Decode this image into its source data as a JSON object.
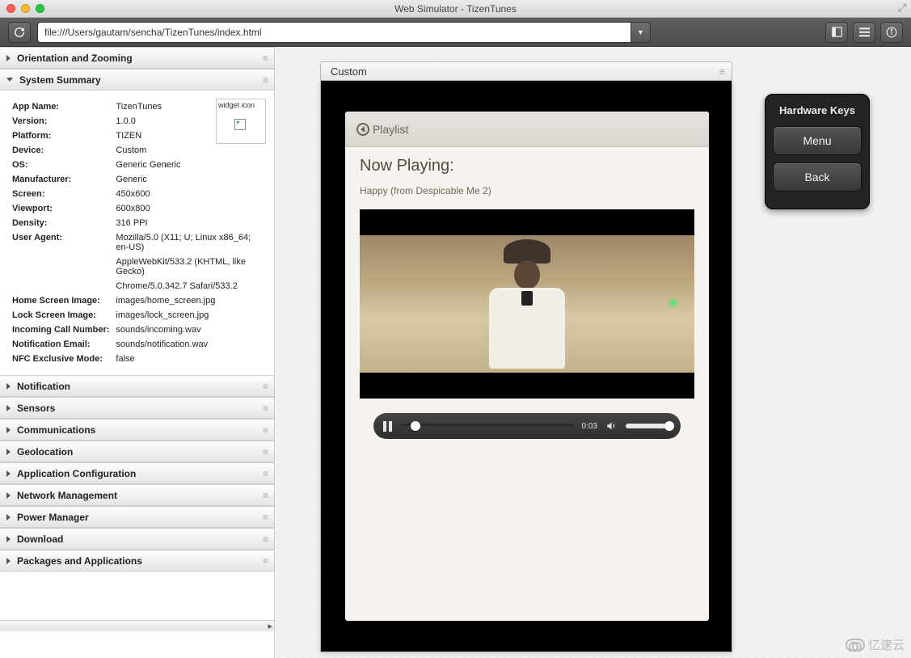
{
  "window": {
    "title": "Web Simulator - TizenTunes"
  },
  "toolbar": {
    "url": "file:///Users/gautam/sencha/TizenTunes/index.html"
  },
  "sidebar": {
    "sections": [
      {
        "label": "Orientation and Zooming",
        "open": false
      },
      {
        "label": "System Summary",
        "open": true
      },
      {
        "label": "Notification",
        "open": false
      },
      {
        "label": "Sensors",
        "open": false
      },
      {
        "label": "Communications",
        "open": false
      },
      {
        "label": "Geolocation",
        "open": false
      },
      {
        "label": "Application Configuration",
        "open": false
      },
      {
        "label": "Network Management",
        "open": false
      },
      {
        "label": "Power Manager",
        "open": false
      },
      {
        "label": "Download",
        "open": false
      },
      {
        "label": "Packages and Applications",
        "open": false
      }
    ],
    "system_summary": {
      "widget_icon_label": "widget icon",
      "rows": {
        "app_name_lbl": "App Name:",
        "app_name": "TizenTunes",
        "version_lbl": "Version:",
        "version": "1.0.0",
        "platform_lbl": "Platform:",
        "platform": "TIZEN",
        "device_lbl": "Device:",
        "device": "Custom",
        "os_lbl": "OS:",
        "os": "Generic Generic",
        "manufacturer_lbl": "Manufacturer:",
        "manufacturer": "Generic",
        "screen_lbl": "Screen:",
        "screen": "450x600",
        "viewport_lbl": "Viewport:",
        "viewport": "600x800",
        "density_lbl": "Density:",
        "density": "316 PPI",
        "ua_lbl": "User Agent:",
        "ua_1": "Mozilla/5.0 (X11; U; Linux x86_64; en-US)",
        "ua_2": "AppleWebKit/533.2 (KHTML, like Gecko)",
        "ua_3": "Chrome/5.0.342.7 Safari/533.2",
        "home_lbl": "Home Screen Image:",
        "home": "images/home_screen.jpg",
        "lock_lbl": "Lock Screen Image:",
        "lock": "images/lock_screen.jpg",
        "call_lbl": "Incoming Call Number:",
        "call": "sounds/incoming.wav",
        "email_lbl": "Notification Email:",
        "email": "sounds/notification.wav",
        "nfc_lbl": "NFC Exclusive Mode:",
        "nfc": "false"
      }
    }
  },
  "device": {
    "panel_title": "Custom",
    "app": {
      "back_label": "Playlist",
      "heading": "Now Playing:",
      "track": "Happy (from Despicable Me 2)",
      "time": "0:03",
      "progress_pct": 6,
      "volume_pct": 90
    }
  },
  "hardware_keys": {
    "title": "Hardware Keys",
    "menu": "Menu",
    "back": "Back"
  },
  "watermark": "亿速云"
}
